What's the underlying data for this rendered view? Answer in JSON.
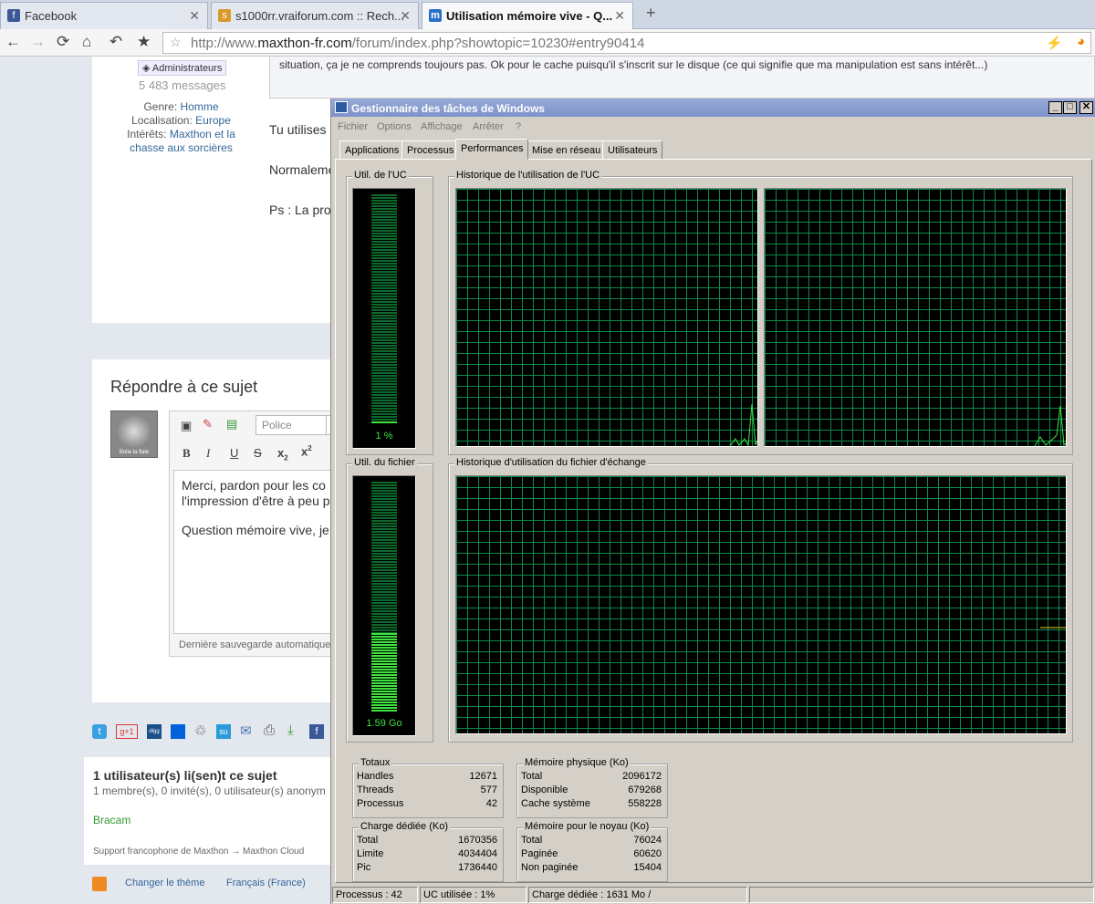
{
  "browser": {
    "tabs": [
      {
        "label": "Facebook",
        "icon": "f"
      },
      {
        "label": "s1000rr.vraiforum.com :: Rech...",
        "icon": "s"
      },
      {
        "label": "Utilisation mémoire vive - Q...",
        "icon": "m"
      }
    ],
    "new_tab": "+",
    "url_prefix": "http://www.",
    "url_domain": "maxthon-fr.com",
    "url_path": "/forum/index.php?showtopic=10230#entry90414"
  },
  "profile": {
    "group": "Administrateurs",
    "messages": "5 483 messages",
    "genre_label": "Genre:",
    "genre": "Homme",
    "loc_label": "Localisation:",
    "loc": "Europe",
    "int_label": "Intérêts:",
    "int_value": "Maxthon et la",
    "int_value2": "chasse aux sorcières"
  },
  "post": {
    "quote": "situation, ça je ne comprends toujours pas. Ok pour le cache puisqu'il s'inscrit sur le disque (ce qui signifie que ma manipulation est sans intérêt...)",
    "line1": "Tu utilises",
    "line2": "Normaleme",
    "line3": "Ps : La pro"
  },
  "reply": {
    "title": "Répondre à ce sujet",
    "font_placeholder": "Police",
    "text1": "Merci, pardon pour les co",
    "text2": "l'impression d'être à peu p",
    "text3": "Question mémoire vive, je",
    "autosave": "Dernière sauvegarde automatique :",
    "avatar_caption": "Bolie la fiale"
  },
  "online": {
    "title": "1 utilisateur(s) li(sen)t ce sujet",
    "sub": "1 membre(s), 0 invité(s), 0 utilisateur(s) anonym",
    "member": "Bracam",
    "breadcrumb1": "Support francophone de Maxthon",
    "arrow": "→",
    "breadcrumb2": "Maxthon Cloud"
  },
  "footer": {
    "theme": "Changer le thème",
    "lang": "Français (France)"
  },
  "taskmgr": {
    "title": "Gestionnaire des tâches de Windows",
    "menu": [
      "Fichier",
      "Options",
      "Affichage",
      "Arrêter",
      "?"
    ],
    "tabs": [
      "Applications",
      "Processus",
      "Performances",
      "Mise en réseau",
      "Utilisateurs"
    ],
    "cpu_label": "Util. de l'UC",
    "cpu_value": "1 %",
    "cpu_percent": 1,
    "cpu_hist_label": "Historique de l'utilisation de l'UC",
    "file_label": "Util. du fichier",
    "file_value": "1.59 Go",
    "file_fraction": 0.34,
    "file_hist_label": "Historique d'utilisation du fichier d'échange",
    "totaux": {
      "title": "Totaux",
      "rows": [
        [
          "Handles",
          "12671"
        ],
        [
          "Threads",
          "577"
        ],
        [
          "Processus",
          "42"
        ]
      ]
    },
    "physique": {
      "title": "Mémoire physique (Ko)",
      "rows": [
        [
          "Total",
          "2096172"
        ],
        [
          "Disponible",
          "679268"
        ],
        [
          "Cache système",
          "558228"
        ]
      ]
    },
    "charge": {
      "title": "Charge dédiée (Ko)",
      "rows": [
        [
          "Total",
          "1670356"
        ],
        [
          "Limite",
          "4034404"
        ],
        [
          "Pic",
          "1736440"
        ]
      ]
    },
    "noyau": {
      "title": "Mémoire pour le noyau (Ko)",
      "rows": [
        [
          "Total",
          "76024"
        ],
        [
          "Paginée",
          "60620"
        ],
        [
          "Non paginée",
          "15404"
        ]
      ]
    },
    "status": [
      "Processus : 42",
      "UC utilisée : 1%",
      "Charge dédiée : 1631 Mo /"
    ]
  }
}
